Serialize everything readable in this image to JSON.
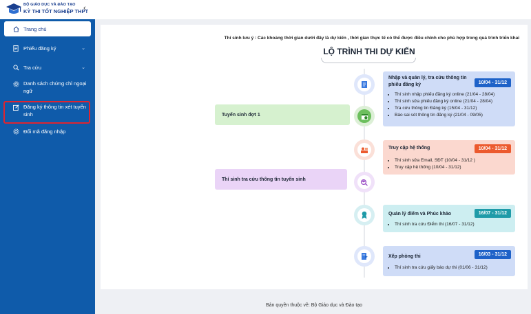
{
  "header": {
    "brand_line1": "BỘ GIÁO DỤC VÀ ĐÀO TẠO",
    "brand_line2": "KỲ THI TỐT NGHIỆP THPT",
    "collapse_glyph": "‹"
  },
  "sidebar": {
    "items": [
      {
        "label": "Trang chủ",
        "icon": "home-icon"
      },
      {
        "label": "Phiếu đăng ký",
        "icon": "form-icon",
        "chevron": "⌄"
      },
      {
        "label": "Tra cứu",
        "icon": "search-icon",
        "chevron": "⌄"
      },
      {
        "label_line1": "Danh sách chứng chỉ ngoại",
        "label_line2": "ngữ",
        "icon": "gear-icon"
      },
      {
        "label_line1": "Đăng ký thông tin xét tuyển",
        "label_line2": "sinh",
        "icon": "edit-icon"
      },
      {
        "label": "Đổi mã đăng nhập",
        "icon": "gear-icon"
      }
    ]
  },
  "main": {
    "notice": "Thí sinh lưu ý : Các khoảng thời gian dưới đây là dự kiến , thời gian thực tế có thể được điều chỉnh cho phù hợp trong quá trình triển khai",
    "title": "LỘ TRÌNH THI DỰ KIẾN",
    "steps": [
      {
        "title_line1": "Nhập và quản lý, tra cứu thông tin",
        "title_line2": "phiếu đăng ký",
        "badge": "10/04 - 31/12",
        "items": [
          "Thí sinh nhập phiếu đăng ký online (21/04 - 28/04)",
          "Thí sinh sửa phiếu đăng ký online (21/04 - 28/04)",
          "Tra cứu thông tin Đăng ký (15/04 - 31/12)",
          "Báo sai sót thông tin đăng ký (21/04 - 09/05)"
        ]
      },
      {
        "title": "Truy cập hệ thống",
        "badge": "10/04 - 31/12",
        "items": [
          "Thí sinh sửa Email, SĐT (10/04 - 31/12 )",
          "Truy cập hệ thống (10/04 - 31/12)"
        ]
      },
      {
        "title": "Quản lý điểm và Phúc khảo",
        "badge": "16/07 - 31/12",
        "items": [
          "Thí sinh tra cứu Điểm thi (16/07 - 31/12)"
        ]
      },
      {
        "title": "Xếp phòng thi",
        "badge": "16/03 - 31/12",
        "items": [
          "Thí sinh tra cứu giấy báo dự thi (01/06 - 31/12)"
        ]
      }
    ],
    "left_steps": [
      {
        "title": "Tuyển sinh đợt 1"
      },
      {
        "title": "Thí sinh tra cứu thông tin tuyển sinh"
      }
    ]
  },
  "footer": {
    "text": "Bản quyền thuộc về: Bộ Giáo dục và Đào tạo"
  },
  "colors": {
    "sidebar": "#0f5baa",
    "blue_box": "#cfdcf7",
    "blue_badge": "#1e62c8",
    "red_box": "#fbd8cf",
    "red_badge": "#ec5a2e",
    "teal_box": "#cdeef1",
    "teal_badge": "#1f9ba8",
    "green_box": "#d6f1cf",
    "purple_box": "#ead4f7",
    "highlight": "#e0242f"
  }
}
